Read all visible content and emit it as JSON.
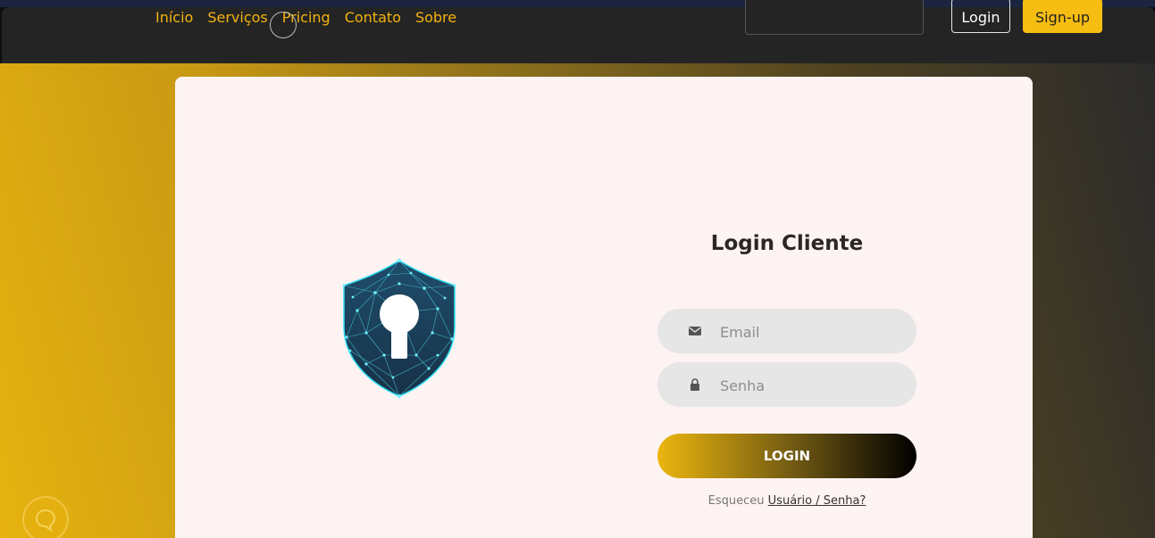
{
  "nav": {
    "links": [
      "Início",
      "Serviços",
      "Pricing",
      "Contato",
      "Sobre"
    ],
    "login_label": "Login",
    "signup_label": "Sign-up",
    "accent_color": "#f6bd12"
  },
  "login": {
    "title": "Login Cliente",
    "email_placeholder": "Email",
    "password_placeholder": "Senha",
    "submit_label": "LOGIN",
    "forgot_prefix": "Esqueceu",
    "forgot_link": "Usuário / Senha?"
  },
  "icons": {
    "email": "envelope-icon",
    "password": "lock-icon",
    "illustration": "shield-keyhole-icon",
    "chat": "chat-bubble-icon"
  }
}
